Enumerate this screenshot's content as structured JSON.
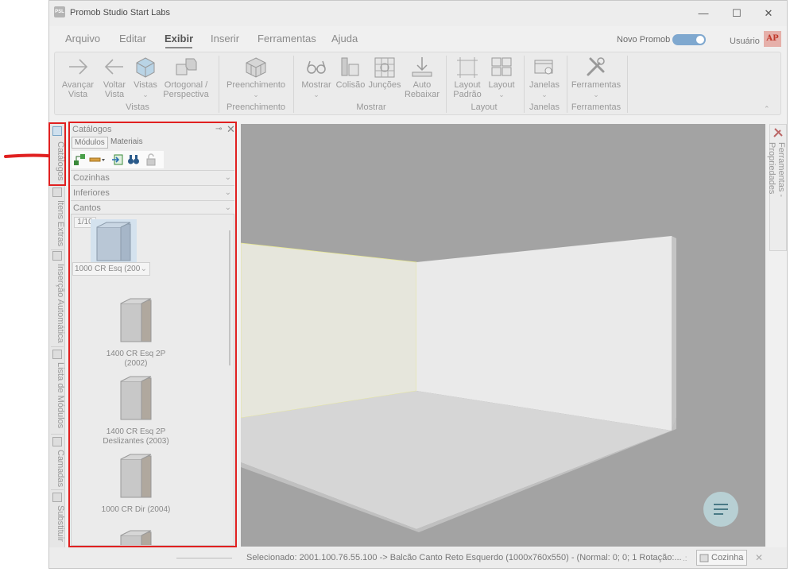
{
  "window": {
    "title": "Promob Studio Start Labs",
    "logo_text": "PSL",
    "controls": [
      "—",
      "☐",
      "✕"
    ]
  },
  "menu": {
    "items": [
      "Arquivo",
      "Editar",
      "Exibir",
      "Inserir",
      "Ferramentas",
      "Ajuda"
    ],
    "active": "Exibir",
    "novo_promob_label": "Novo Promob",
    "novo_promob_on": true,
    "user_label": "Usuário",
    "user_initials": "AP"
  },
  "ribbon": {
    "vistas": {
      "label": "Vistas",
      "buttons": [
        {
          "line1": "Avançar",
          "line2": "Vista",
          "icon": "arrow-right-icon"
        },
        {
          "line1": "Voltar",
          "line2": "Vista",
          "icon": "arrow-left-icon"
        },
        {
          "line1": "Vistas",
          "line2": "⌄",
          "icon": "cube-icon"
        },
        {
          "line1": "Ortogonal /",
          "line2": "Perspectiva",
          "icon": "ortho-cubes-icon"
        }
      ]
    },
    "preenchimento": {
      "label": "Preenchimento",
      "buttons": [
        {
          "line1": "Preenchimento",
          "line2": "⌄",
          "icon": "fill-cube-icon"
        }
      ]
    },
    "mostrar": {
      "label": "Mostrar",
      "buttons": [
        {
          "line1": "Mostrar",
          "line2": "⌄",
          "icon": "glasses-icon"
        },
        {
          "line1": "Colisão",
          "line2": "",
          "icon": "collision-icon"
        },
        {
          "line1": "Junções",
          "line2": "",
          "icon": "joints-icon"
        },
        {
          "line1": "Auto",
          "line2": "Rebaixar",
          "icon": "auto-lower-icon"
        }
      ]
    },
    "layout": {
      "label": "Layout",
      "buttons": [
        {
          "line1": "Layout",
          "line2": "Padrão",
          "icon": "layout-default-icon"
        },
        {
          "line1": "Layout",
          "line2": "⌄",
          "icon": "layout-grid-icon"
        }
      ]
    },
    "janelas": {
      "label": "Janelas",
      "buttons": [
        {
          "line1": "Janelas",
          "line2": "⌄",
          "icon": "windows-gear-icon"
        }
      ]
    },
    "ferramentas": {
      "label": "Ferramentas",
      "buttons": [
        {
          "line1": "Ferramentas",
          "line2": "⌄",
          "icon": "tools-icon"
        }
      ]
    }
  },
  "left_tabs": [
    "Catálogos",
    "Itens Extras",
    "Inserção Automática",
    "Lista de Módulos",
    "Camadas",
    "Substituir"
  ],
  "catalog": {
    "title": "Catálogos",
    "pin": "⊸",
    "close": "✕",
    "tabs": [
      "Módulos",
      "Materiais"
    ],
    "selected_tab": "Módulos",
    "dropdowns": [
      "Cozinhas",
      "Inferiores",
      "Cantos"
    ],
    "page_indicator": "1/10",
    "selected_module_name": "1000 CR Esq (200",
    "modules": [
      {
        "line1": "1400 CR Esq 2P",
        "line2": "(2002)"
      },
      {
        "line1": "1400 CR Esq 2P",
        "line2": "Deslizantes (2003)"
      },
      {
        "line1": "1000 CR Dir (2004)",
        "line2": ""
      }
    ]
  },
  "right_tab": "Ferramentas - Propriedades",
  "status": {
    "text": "Selecionado: 2001.100.76.55.100 -> Balcão Canto Reto Esquerdo (1000x760x550) - (Normal: 0; 0; 1 Rotação:...",
    "environment_button": "Cozinha",
    "close": "✕"
  },
  "colors": {
    "highlight_red": "#e02020",
    "toggle_blue": "#7fa8cf",
    "viewport_gray": "#a3a3a3"
  }
}
